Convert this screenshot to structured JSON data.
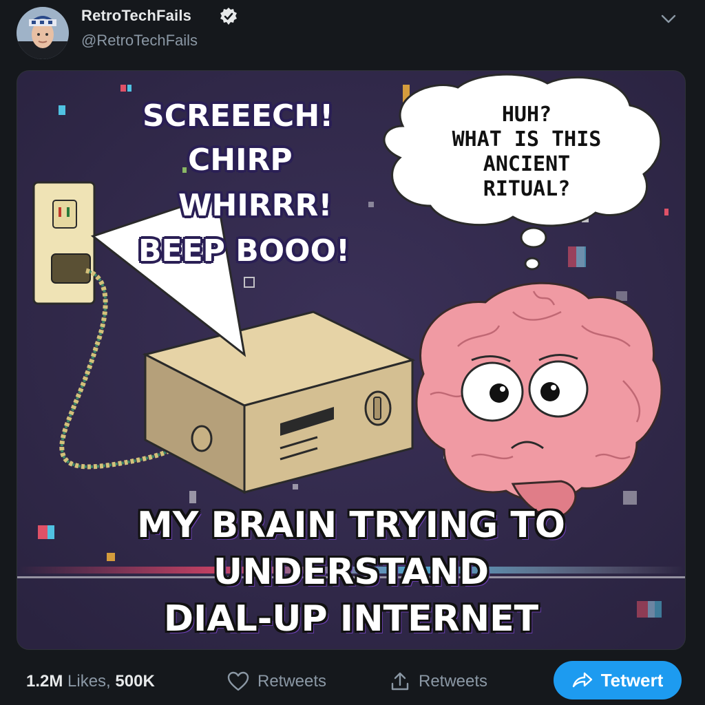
{
  "author": {
    "display_name": "RetroTechFails",
    "handle": "@RetroTechFails",
    "verified": true
  },
  "meme": {
    "sound_lines": [
      "SCREEECH!",
      "CHIRP",
      "WHIRRR!",
      "BEEP BOOO!"
    ],
    "thought_lines": [
      "HUH?",
      "WHAT IS THIS",
      "ANCIENT",
      "RITUAL?"
    ],
    "caption_lines": [
      "MY BRAIN TRYING TO",
      "UNDERSTAND",
      "DIAL-UP INTERNET"
    ]
  },
  "actions": {
    "likes_count": "1.2M",
    "likes_label": "Likes,",
    "retweets_count": "500K",
    "like_label": "Retweets",
    "share_label": "Retweets",
    "primary_button_label": "Tetwert"
  },
  "colors": {
    "background": "#15181c",
    "accent": "#1d9bf0",
    "media_bg": "#2f2747",
    "brain_pink": "#f09aa3",
    "modem_beige": "#d9c49a"
  },
  "icons": [
    "verified-icon",
    "chevron-down-icon",
    "heart-icon",
    "share-icon",
    "retweet-arrow-icon"
  ]
}
